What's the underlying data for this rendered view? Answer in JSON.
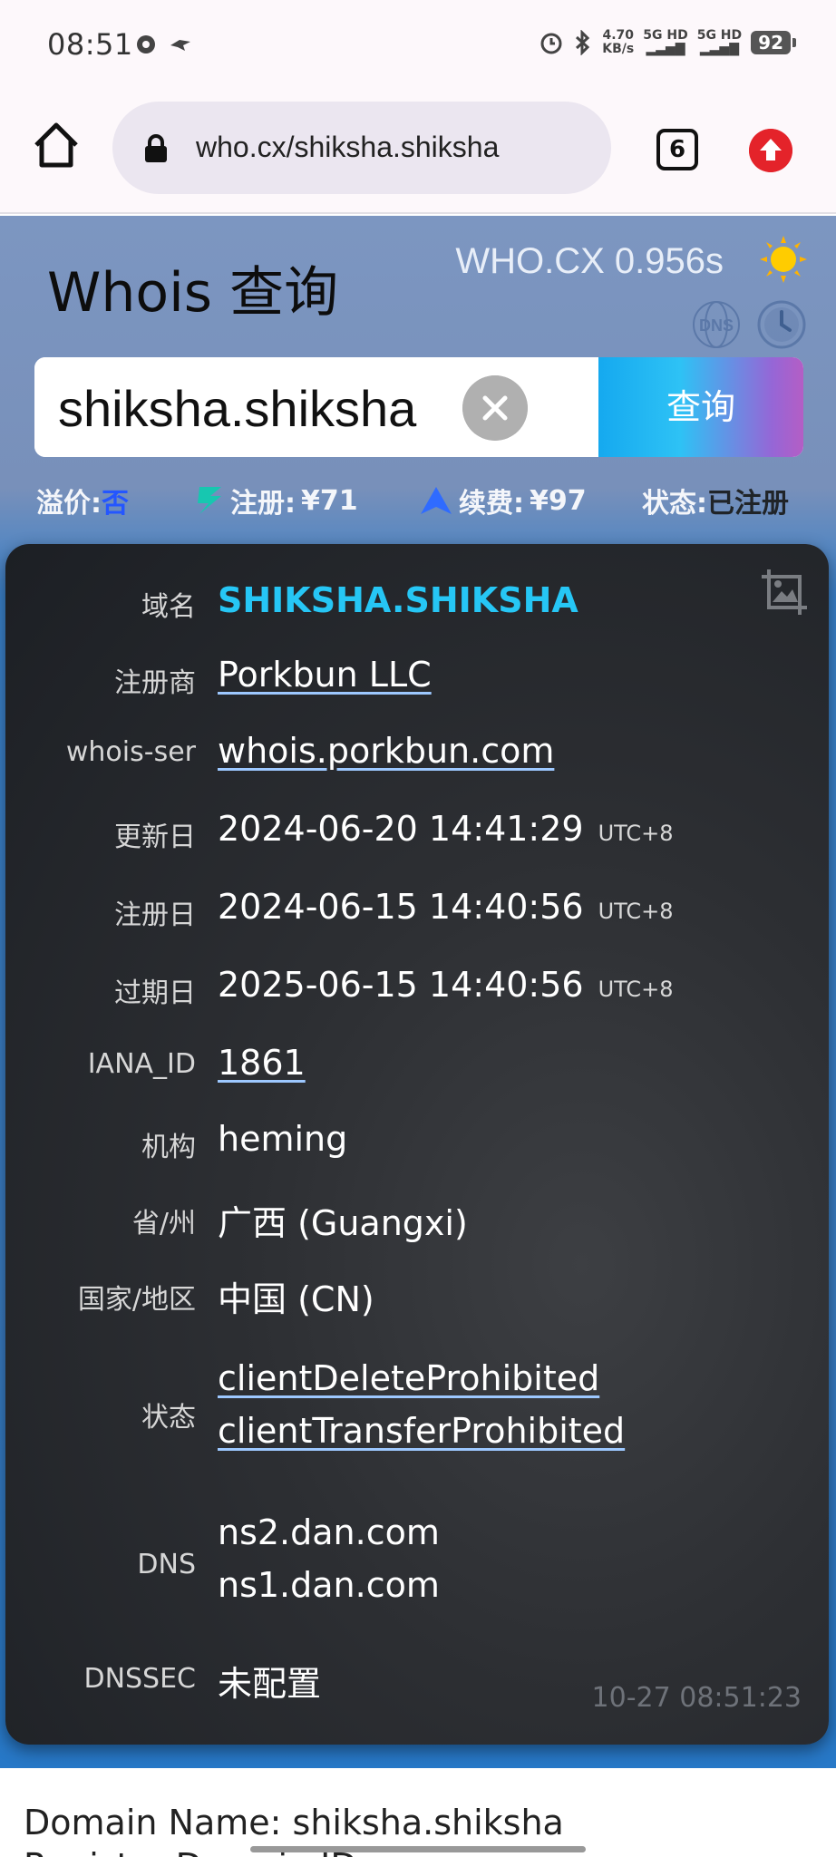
{
  "status_bar": {
    "time": "08:51",
    "network_speed": "4.70\nKB/s",
    "sim1": "5G HD",
    "sim2": "5G HD",
    "battery": "92"
  },
  "browser": {
    "url": "who.cx/shiksha.shiksha",
    "tab_count": "6",
    "icons": [
      "home-icon",
      "lock-icon",
      "tabs-icon",
      "upgrade-arrow-icon"
    ]
  },
  "header": {
    "title": "Whois 查询",
    "brand": "WHO.CX 0.956s",
    "icons": [
      "sun-icon",
      "dns-icon",
      "history-clock-icon"
    ]
  },
  "search": {
    "value": "shiksha.shiksha",
    "button_label": "查询"
  },
  "infobar": {
    "premium_label": "溢价:",
    "premium_value": "否",
    "register_label": "注册:",
    "register_value": "¥71",
    "renew_label": "续费:",
    "renew_value": "¥97",
    "status_label": "状态:",
    "status_value": "已注册"
  },
  "card": {
    "rows": {
      "domain": {
        "label": "域名",
        "value": "SHIKSHA.SHIKSHA"
      },
      "registrar": {
        "label": "注册商",
        "value": "Porkbun LLC"
      },
      "whois_server": {
        "label": "whois-ser",
        "value": "whois.porkbun.com"
      },
      "updated": {
        "label": "更新日",
        "value": "2024-06-20 14:41:29",
        "tz": "UTC+8"
      },
      "created": {
        "label": "注册日",
        "value": "2024-06-15 14:40:56",
        "tz": "UTC+8"
      },
      "expires": {
        "label": "过期日",
        "value": "2025-06-15 14:40:56",
        "tz": "UTC+8"
      },
      "iana_id": {
        "label": "IANA_ID",
        "value": "1861"
      },
      "organization": {
        "label": "机构",
        "value": "heming"
      },
      "province": {
        "label": "省/州",
        "value": "广西 (Guangxi)"
      },
      "country": {
        "label": "国家/地区",
        "value": "中国 (CN)"
      },
      "status": {
        "label": "状态",
        "values": [
          "clientDeleteProhibited",
          "clientTransferProhibited"
        ]
      },
      "dns": {
        "label": "DNS",
        "values": [
          "ns2.dan.com",
          "ns1.dan.com"
        ]
      },
      "dnssec": {
        "label": "DNSSEC",
        "value": "未配置"
      }
    },
    "timestamp": "10-27 08:51:23"
  },
  "raw": {
    "line1": "Domain Name: shiksha.shiksha",
    "line2": "Registry Domain ID:"
  }
}
